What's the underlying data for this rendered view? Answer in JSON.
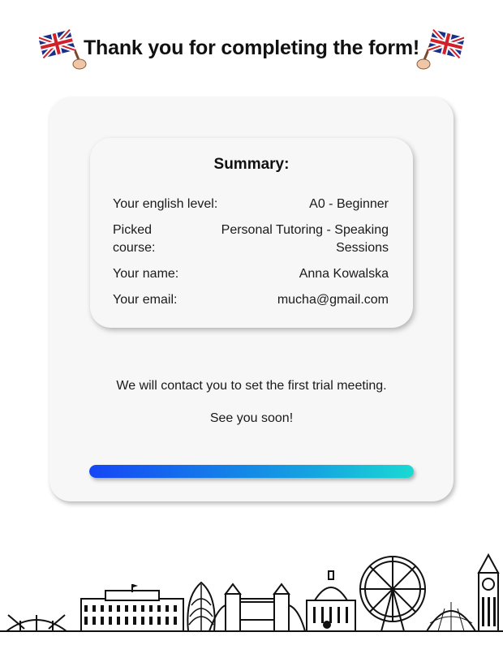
{
  "header": {
    "title": "Thank you for completing the form!",
    "flag_icon": "uk-flag-icon"
  },
  "summary": {
    "title": "Summary:",
    "rows": [
      {
        "label": "Your english level:",
        "value": "A0 - Beginner"
      },
      {
        "label": "Picked course:",
        "value": "Personal Tutoring - Speaking Sessions"
      },
      {
        "label": "Your name:",
        "value": "Anna Kowalska"
      },
      {
        "label": "Your email:",
        "value": "mucha@gmail.com"
      }
    ]
  },
  "messages": {
    "contact": "We will contact you to set the first trial meeting.",
    "farewell": "See you soon!"
  },
  "progress": {
    "fraction": 1.0,
    "colors": [
      "#1546f5",
      "#15a6e0",
      "#1bd9d3"
    ]
  },
  "footer": {
    "illustration": "london-skyline-illustration"
  }
}
